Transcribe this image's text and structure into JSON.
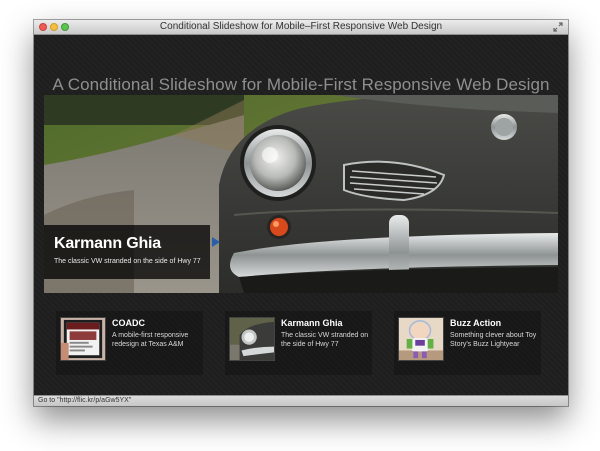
{
  "window": {
    "title": "Conditional Slideshow for Mobile–First Responsive Web Design",
    "controls": [
      "close",
      "minimize",
      "zoom"
    ],
    "fullscreen_icon": "fullscreen-icon"
  },
  "page": {
    "heading": "A Conditional Slideshow for Mobile-First Responsive Web Design"
  },
  "slideshow": {
    "current": {
      "title": "Karmann Ghia",
      "description": "The classic VW stranded on the side of Hwy 77"
    },
    "thumbnails": [
      {
        "title": "COADC",
        "description": "A mobile-first responsive redesign at Texas A&M",
        "icon": "phone-screenshot-icon"
      },
      {
        "title": "Karmann Ghia",
        "description": "The classic VW stranded on the side of Hwy 77",
        "icon": "car-photo-icon"
      },
      {
        "title": "Buzz Action",
        "description": "Something clever about Toy Story's Buzz Lightyear",
        "icon": "toy-photo-icon"
      }
    ]
  },
  "statusbar": {
    "text": "Go to \"http://flic.kr/p/aGw5YX\""
  }
}
